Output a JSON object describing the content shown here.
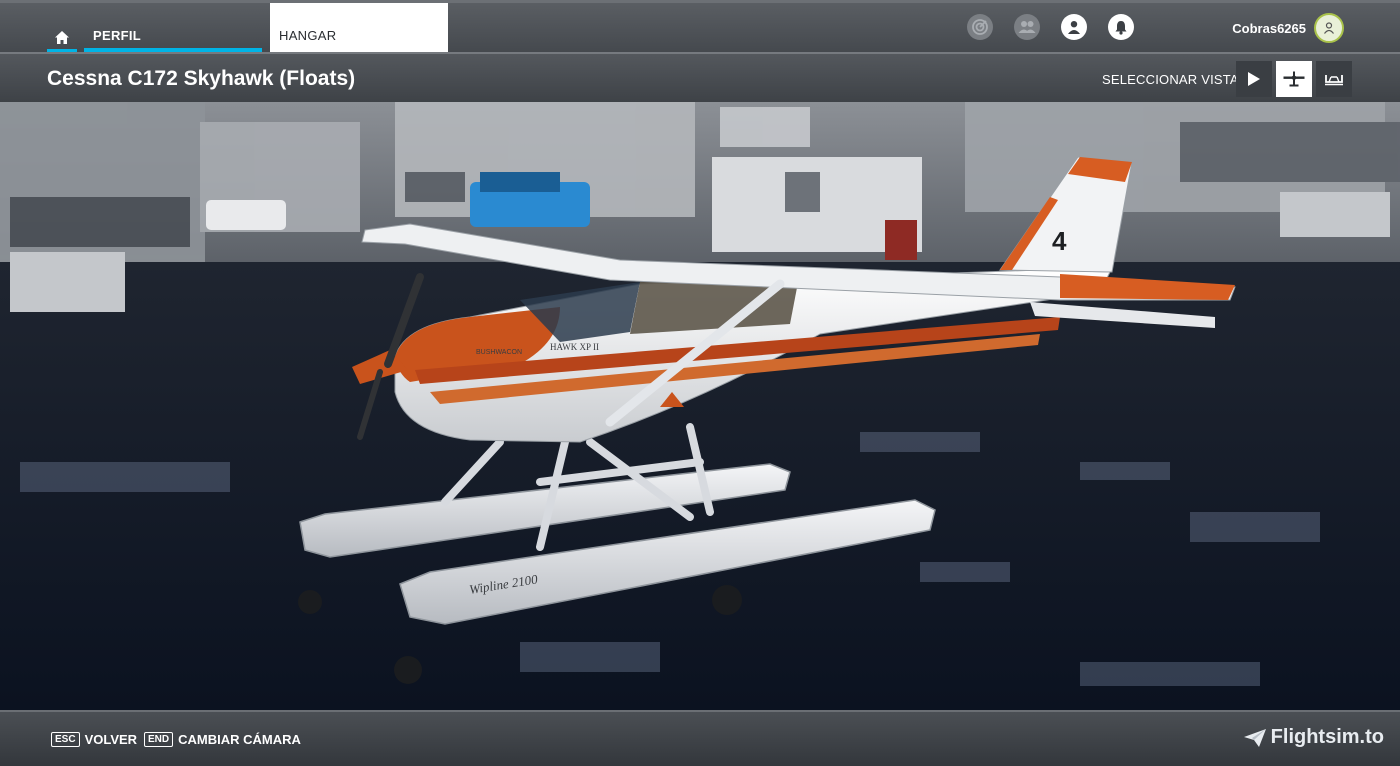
{
  "nav": {
    "tabs": [
      {
        "label": "PERFIL"
      },
      {
        "label": "HANGAR"
      }
    ],
    "icons": [
      "achievements-icon",
      "friends-icon",
      "profile-icon",
      "notifications-icon"
    ],
    "username": "Cobras6265",
    "accent_color": "#00b4e6"
  },
  "header": {
    "title": "Cessna C172 Skyhawk (Floats)",
    "view_label": "SELECCIONAR VISTA",
    "view_buttons": [
      "play-icon",
      "aircraft-icon",
      "floats-icon"
    ]
  },
  "viewport": {
    "livery_text": [
      "HAWK XP II",
      "BUSHWACON",
      "Wipline 2100"
    ],
    "tail_number": "4"
  },
  "footer": {
    "hints": [
      {
        "key": "ESC",
        "label": "VOLVER"
      },
      {
        "key": "END",
        "label": "CAMBIAR CÁMARA"
      }
    ],
    "brand": "Flightsim.to"
  }
}
